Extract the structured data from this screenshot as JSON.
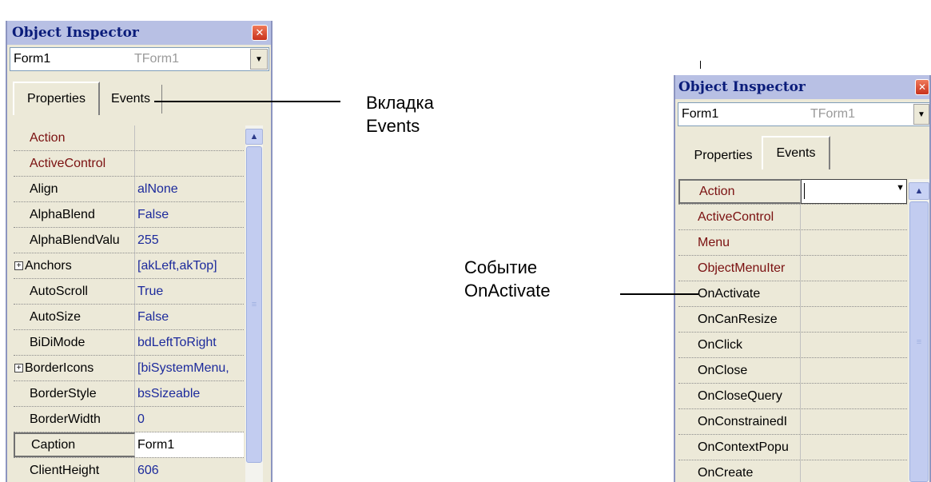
{
  "left_inspector": {
    "title": "Object Inspector",
    "object_name": "Form1",
    "object_type": "TForm1",
    "tabs": [
      "Properties",
      "Events"
    ],
    "active_tab": "Properties",
    "rows": [
      {
        "name": "Action",
        "value": "",
        "name_color": "red"
      },
      {
        "name": "ActiveControl",
        "value": "",
        "name_color": "red"
      },
      {
        "name": "Align",
        "value": "alNone"
      },
      {
        "name": "AlphaBlend",
        "value": "False"
      },
      {
        "name": "AlphaBlendValu",
        "value": "255"
      },
      {
        "name": "Anchors",
        "value": "[akLeft,akTop]",
        "expandable": true
      },
      {
        "name": "AutoScroll",
        "value": "True"
      },
      {
        "name": "AutoSize",
        "value": "False"
      },
      {
        "name": "BiDiMode",
        "value": "bdLeftToRight"
      },
      {
        "name": "BorderIcons",
        "value": "[biSystemMenu,",
        "expandable": true
      },
      {
        "name": "BorderStyle",
        "value": "bsSizeable"
      },
      {
        "name": "BorderWidth",
        "value": "0"
      },
      {
        "name": "Caption",
        "value": "Form1",
        "selected": true
      },
      {
        "name": "ClientHeight",
        "value": "606"
      }
    ]
  },
  "right_inspector": {
    "title": "Object Inspector",
    "object_name": "Form1",
    "object_type": "TForm1",
    "tabs": [
      "Properties",
      "Events"
    ],
    "active_tab": "Events",
    "rows": [
      {
        "name": "Action",
        "value": "",
        "name_color": "red",
        "selected": true
      },
      {
        "name": "ActiveControl",
        "value": "",
        "name_color": "red"
      },
      {
        "name": "Menu",
        "value": "",
        "name_color": "red"
      },
      {
        "name": "ObjectMenuIter",
        "value": "",
        "name_color": "red"
      },
      {
        "name": "OnActivate",
        "value": ""
      },
      {
        "name": "OnCanResize",
        "value": ""
      },
      {
        "name": "OnClick",
        "value": ""
      },
      {
        "name": "OnClose",
        "value": ""
      },
      {
        "name": "OnCloseQuery",
        "value": ""
      },
      {
        "name": "OnConstrainedI",
        "value": ""
      },
      {
        "name": "OnContextPopu",
        "value": ""
      },
      {
        "name": "OnCreate",
        "value": ""
      }
    ]
  },
  "annotations": {
    "events_tab": [
      "Вкладка",
      "Events"
    ],
    "onactivate_event": [
      "Событие",
      "OnActivate"
    ]
  },
  "icons": {
    "close": "close-icon",
    "dropdown": "chevron-down-icon",
    "scroll_up": "chevron-up-icon",
    "scroll_grip": "grip-icon",
    "expand": "plus-box-icon"
  },
  "colors": {
    "title_bg": "#b8c0e4",
    "title_text": "#0a1c7a",
    "panel_bg": "#ece9d8",
    "property_name_required": "#7a1010",
    "property_value": "#1c2a9c"
  }
}
